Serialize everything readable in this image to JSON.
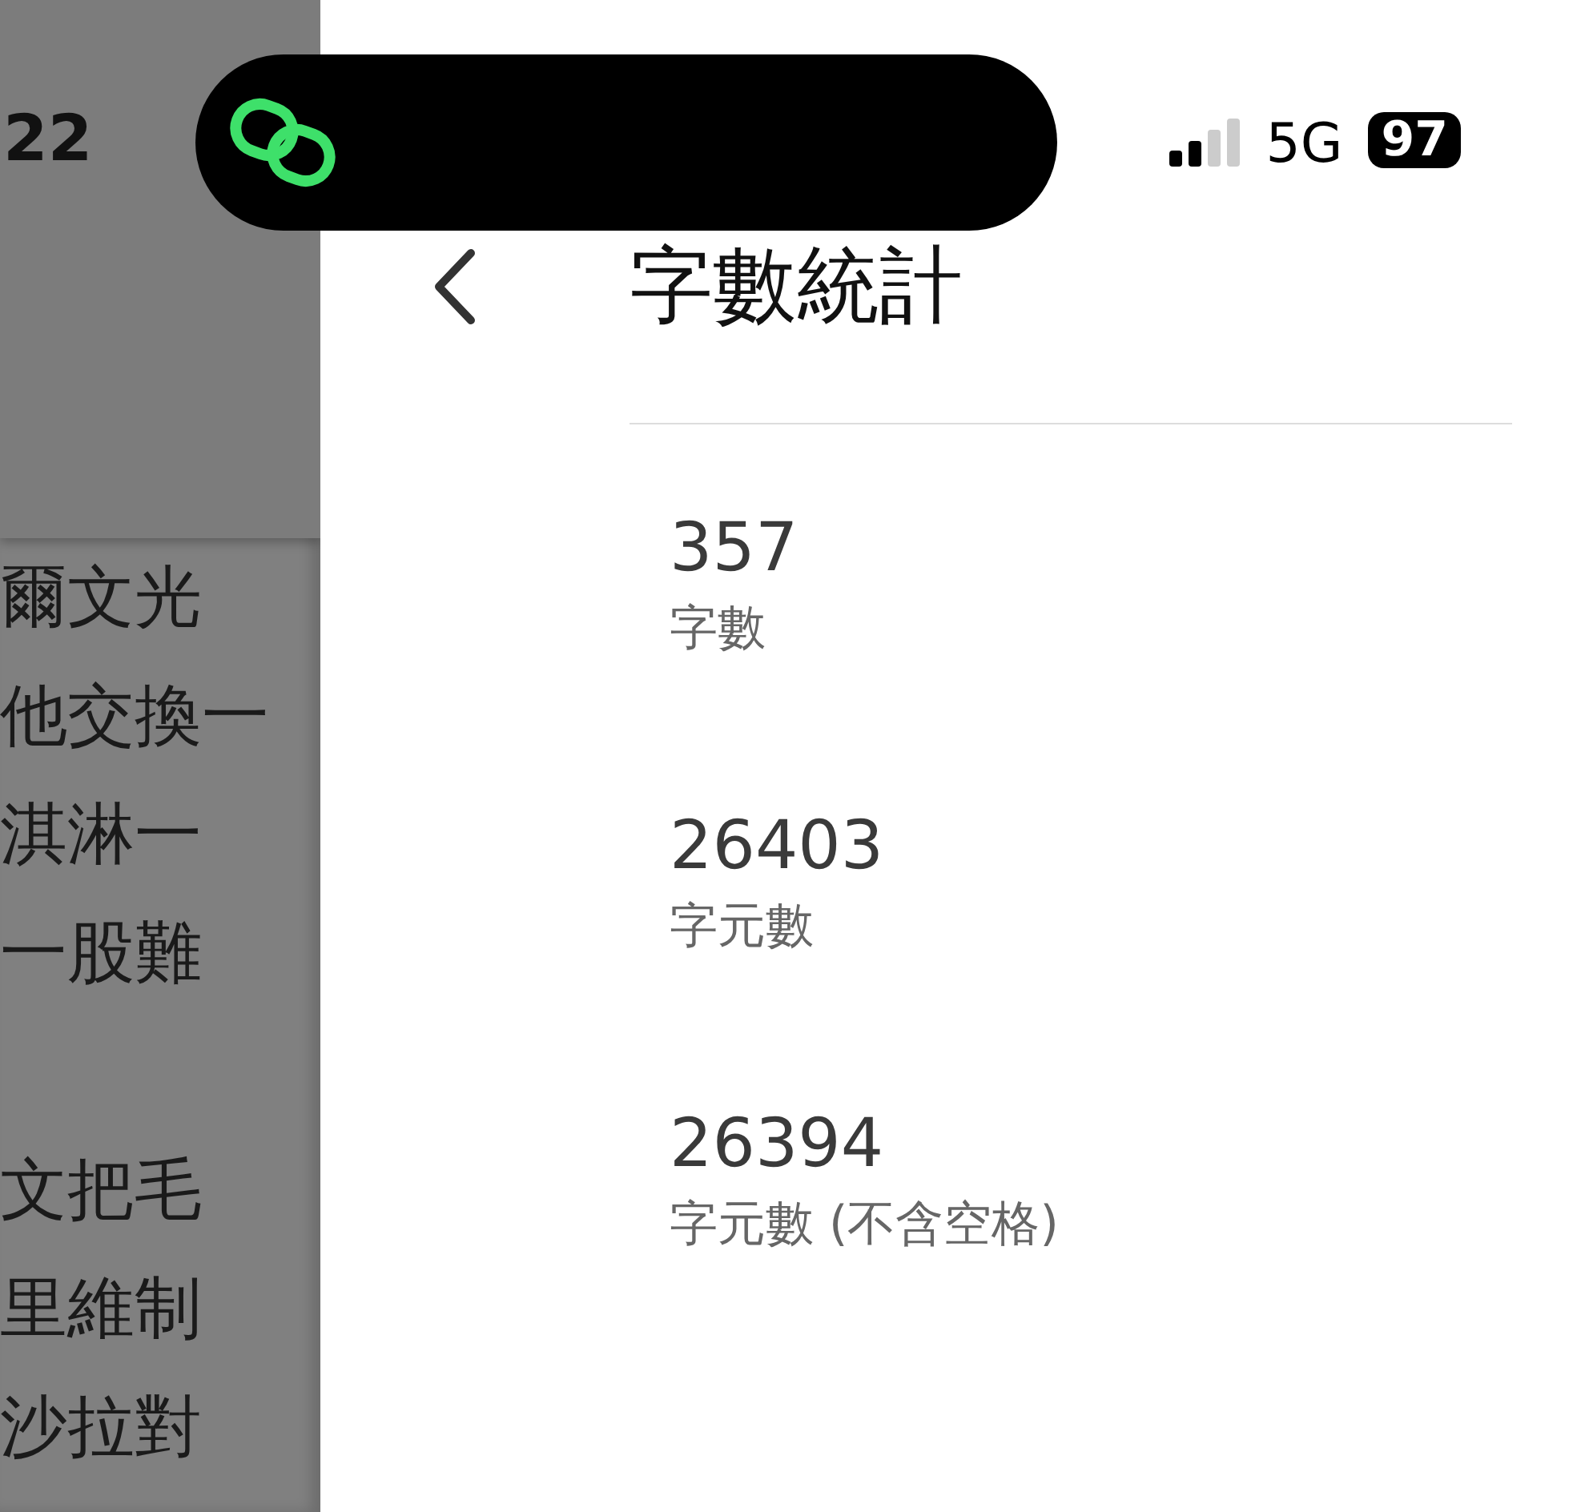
{
  "status_bar": {
    "time": "22",
    "network": "5G",
    "battery": "97"
  },
  "background_document": {
    "paragraphs": [
      [
        "爾文光",
        "他交換一",
        "淇淋一",
        "一股難"
      ],
      [
        "文把毛",
        "里維制",
        "沙拉對"
      ]
    ]
  },
  "header": {
    "title": "字數統計"
  },
  "stats": [
    {
      "value": "357",
      "label": "字數"
    },
    {
      "value": "26403",
      "label": "字元數"
    },
    {
      "value": "26394",
      "label": "字元數 (不含空格)"
    }
  ]
}
